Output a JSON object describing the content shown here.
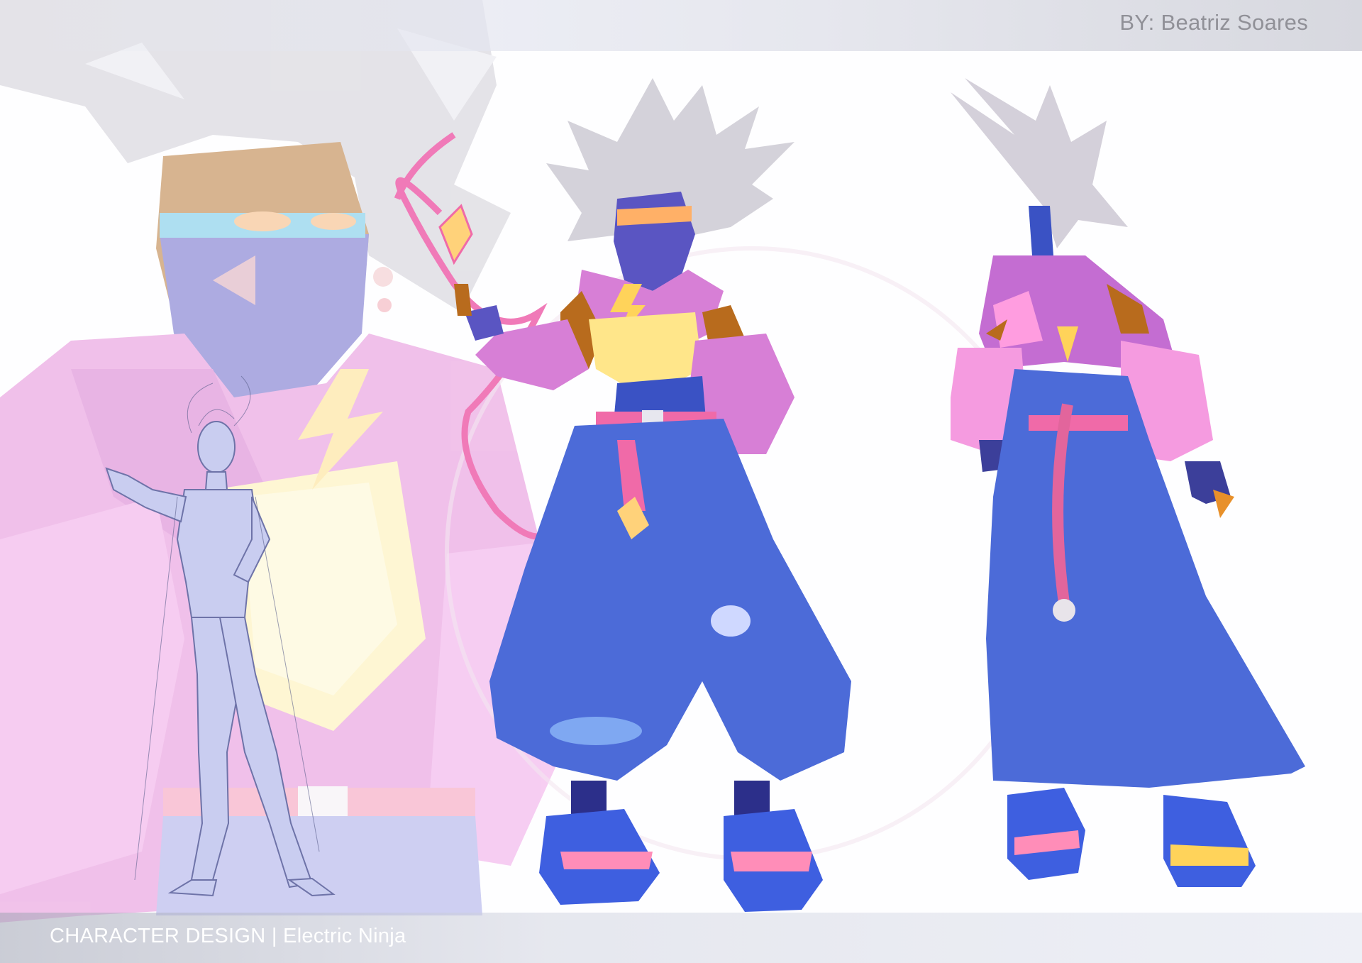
{
  "header": {
    "author_credit": "BY: Beatriz Soares"
  },
  "footer": {
    "caption": "CHARACTER DESIGN | Electric Ninja"
  },
  "colors": {
    "hair": "#cfcdd6",
    "skin": "#b86b1d",
    "mask": "#5a55c2",
    "hoodie": "#d77fd6",
    "pants": "#4c6bd8",
    "accent_pink": "#f06aa8",
    "glow_yellow": "#ffe68a",
    "sketch": "#9aa1d6"
  }
}
